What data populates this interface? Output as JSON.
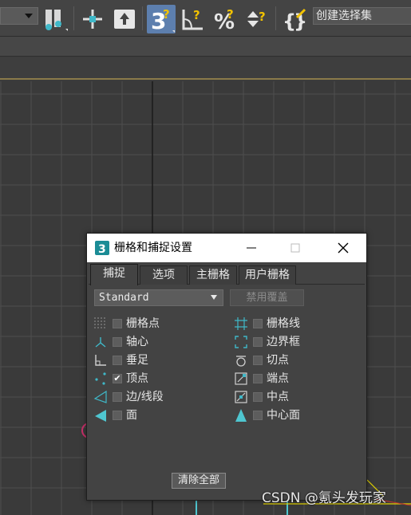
{
  "toolbar": {
    "selection_set_name": "创建选择集",
    "snap_toggle_label": "3"
  },
  "dialog": {
    "title": "栅格和捕捉设置",
    "tabs": [
      {
        "label": "捕捉",
        "active": true
      },
      {
        "label": "选项",
        "active": false
      },
      {
        "label": "主栅格",
        "active": false
      },
      {
        "label": "用户栅格",
        "active": false
      }
    ],
    "preset": {
      "selected": "Standard"
    },
    "override_label": "禁用覆盖",
    "snaps_left": [
      {
        "label": "栅格点",
        "icon": "grid-points-icon",
        "checked": false
      },
      {
        "label": "轴心",
        "icon": "pivot-icon",
        "checked": false
      },
      {
        "label": "垂足",
        "icon": "perpendicular-icon",
        "checked": false
      },
      {
        "label": "顶点",
        "icon": "vertex-icon",
        "checked": true
      },
      {
        "label": "边/线段",
        "icon": "edge-segment-icon",
        "checked": false
      },
      {
        "label": "面",
        "icon": "face-icon",
        "checked": false
      }
    ],
    "snaps_right": [
      {
        "label": "栅格线",
        "icon": "grid-lines-icon",
        "checked": false
      },
      {
        "label": "边界框",
        "icon": "bounding-box-icon",
        "checked": false
      },
      {
        "label": "切点",
        "icon": "tangent-icon",
        "checked": false
      },
      {
        "label": "端点",
        "icon": "endpoint-icon",
        "checked": false
      },
      {
        "label": "中点",
        "icon": "midpoint-icon",
        "checked": false
      },
      {
        "label": "中心面",
        "icon": "center-face-icon",
        "checked": false
      }
    ],
    "clear_all_label": "清除全部"
  },
  "watermark": "CSDN @氪头发玩家",
  "colors": {
    "snap_active": "#5d7fae",
    "accent_cyan": "#4fc6d0",
    "viewport_bg": "#3a3a3a"
  }
}
